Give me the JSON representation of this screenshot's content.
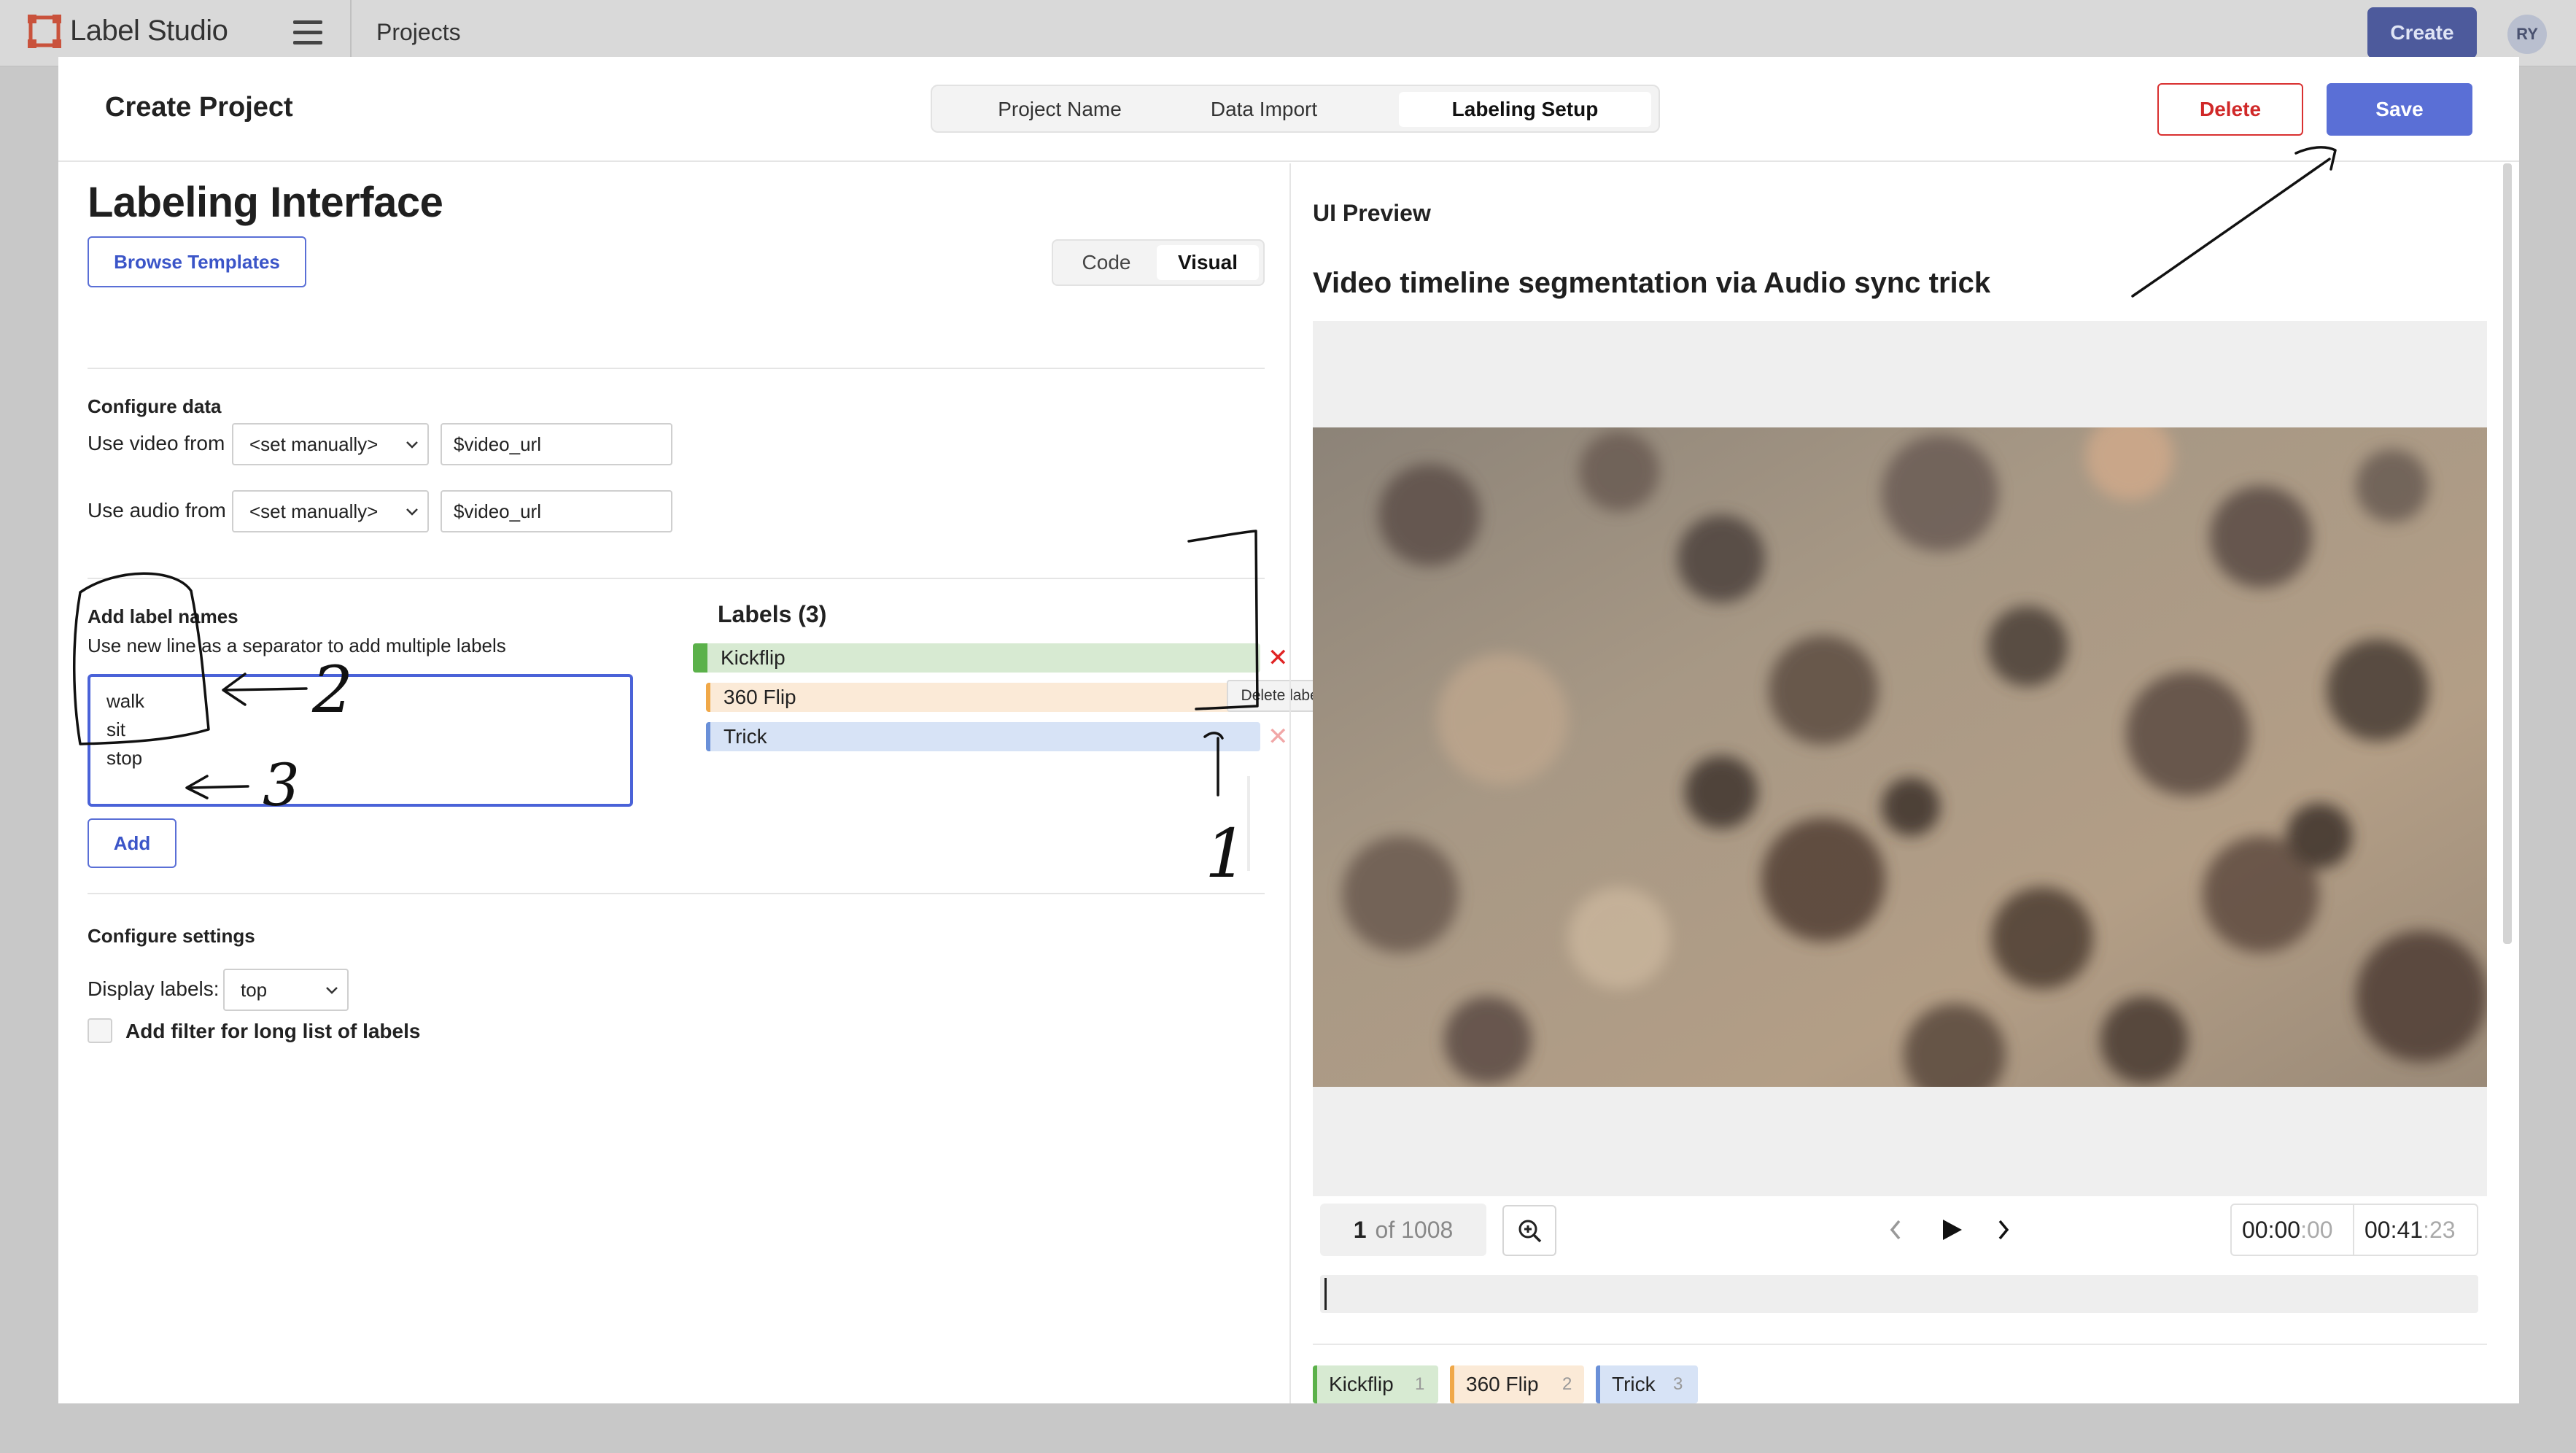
{
  "app": {
    "name": "Label Studio",
    "breadcrumb": "Projects",
    "create_label": "Create",
    "avatar_initials": "RY"
  },
  "modal": {
    "title": "Create Project",
    "tabs": [
      {
        "label": "Project Name",
        "active": false
      },
      {
        "label": "Data Import",
        "active": false
      },
      {
        "label": "Labeling Setup",
        "active": true
      }
    ],
    "delete_label": "Delete",
    "save_label": "Save"
  },
  "left": {
    "heading": "Labeling Interface",
    "browse_label": "Browse Templates",
    "view_toggle": {
      "code": "Code",
      "visual": "Visual",
      "active": "Visual"
    },
    "configure_data": {
      "title": "Configure data",
      "video_label": "Use video from",
      "video_select": "<set manually>",
      "video_value": "$video_url",
      "audio_label": "Use audio from",
      "audio_select": "<set manually>",
      "audio_value": "$video_url"
    },
    "add_labels": {
      "title": "Add label names",
      "hint": "Use new line as a separator to add multiple labels",
      "textarea_value": "walk\nsit\nstop",
      "add_label": "Add"
    },
    "labels": {
      "title": "Labels (3)",
      "items": [
        {
          "name": "Kickflip",
          "color": "#5bb14a",
          "bg": "#d7ead2"
        },
        {
          "name": "360 Flip",
          "color": "#f0a848",
          "bg": "#fbead7"
        },
        {
          "name": "Trick",
          "color": "#6a90d8",
          "bg": "#d7e3f6"
        }
      ],
      "tooltip": "Delete label"
    },
    "configure_settings": {
      "title": "Configure settings",
      "display_labels_label": "Display labels:",
      "display_labels_value": "top",
      "filter_label": "Add filter for long list of labels"
    }
  },
  "preview": {
    "label": "UI Preview",
    "title": "Video timeline segmentation via Audio sync trick",
    "frame_current": "1",
    "frame_total": "of 1008",
    "time_current": "00:00",
    "time_current_frac": ":00",
    "time_total": "00:41",
    "time_total_frac": ":23",
    "chips": [
      {
        "name": "Kickflip",
        "hotkey": "1",
        "color": "#5bb14a",
        "bg": "#d7ead2"
      },
      {
        "name": "360 Flip",
        "hotkey": "2",
        "color": "#f0a848",
        "bg": "#fbead7"
      },
      {
        "name": "Trick",
        "hotkey": "3",
        "color": "#6a90d8",
        "bg": "#d7e3f6"
      }
    ]
  },
  "annotations": {
    "num_1": "1",
    "num_2": "2",
    "num_3": "3"
  },
  "colors": {
    "accent": "#5a6fd6",
    "danger": "#d93030"
  }
}
